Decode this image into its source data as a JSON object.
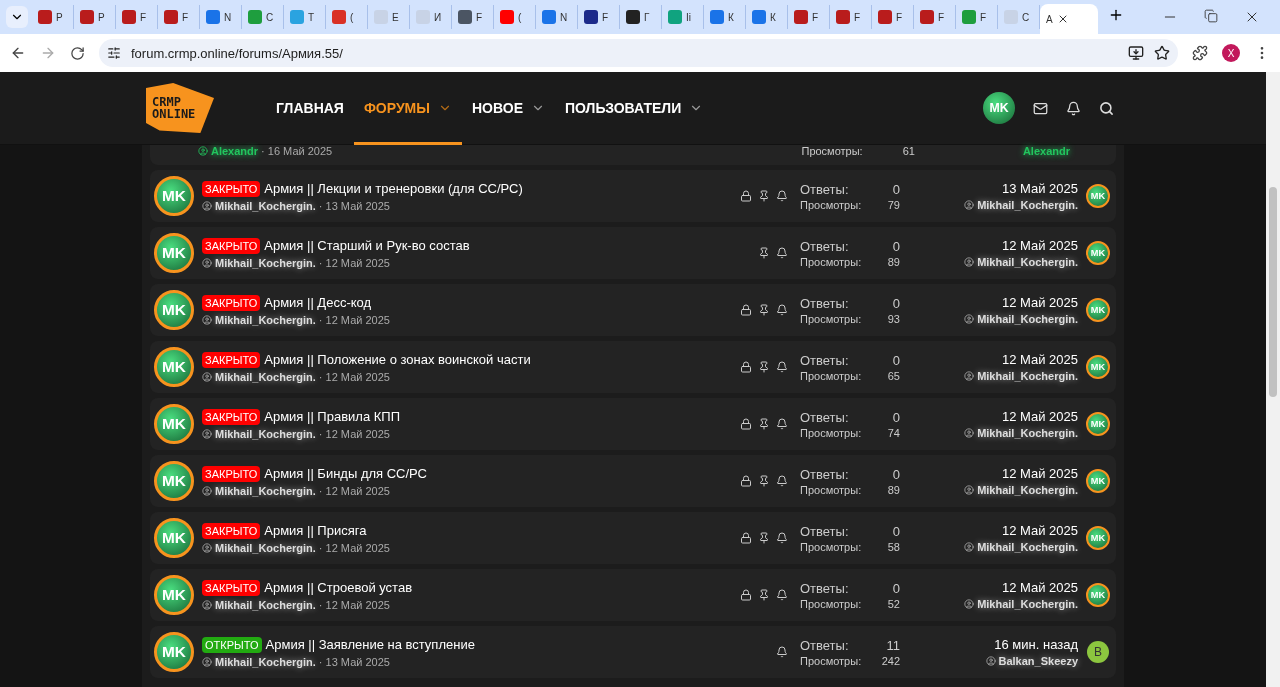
{
  "browser": {
    "tabs": [
      {
        "title": "Р",
        "color": "#b91c1c",
        "selected": false
      },
      {
        "title": "Р",
        "color": "#b91c1c",
        "selected": false
      },
      {
        "title": "F",
        "color": "#b91c1c",
        "selected": false
      },
      {
        "title": "F",
        "color": "#b91c1c",
        "selected": false
      },
      {
        "title": "N",
        "color": "#1a73e8",
        "selected": false
      },
      {
        "title": "С",
        "color": "#1e9e3e",
        "selected": false
      },
      {
        "title": "Т",
        "color": "#2aa3e0",
        "selected": false
      },
      {
        "title": "(",
        "color": "#d93025",
        "selected": false
      },
      {
        "title": "Е",
        "color": "#c8d3e6",
        "selected": false
      },
      {
        "title": "И",
        "color": "#c8d3e6",
        "selected": false
      },
      {
        "title": "F",
        "color": "#4b5563",
        "selected": false
      },
      {
        "title": "(",
        "color": "#ff0000",
        "selected": false
      },
      {
        "title": "N",
        "color": "#1a73e8",
        "selected": false
      },
      {
        "title": "F",
        "color": "#1c2a8a",
        "selected": false
      },
      {
        "title": "Г",
        "color": "#222222",
        "selected": false
      },
      {
        "title": "Іі",
        "color": "#10a37f",
        "selected": false
      },
      {
        "title": "К",
        "color": "#1a73e8",
        "selected": false
      },
      {
        "title": "К",
        "color": "#1a73e8",
        "selected": false
      },
      {
        "title": "F",
        "color": "#b91c1c",
        "selected": false
      },
      {
        "title": "F",
        "color": "#b91c1c",
        "selected": false
      },
      {
        "title": "F",
        "color": "#b91c1c",
        "selected": false
      },
      {
        "title": "F",
        "color": "#b91c1c",
        "selected": false
      },
      {
        "title": "F",
        "color": "#1e9e3e",
        "selected": false
      },
      {
        "title": "С",
        "color": "#c8d3e6",
        "selected": false
      },
      {
        "title": "А",
        "selected": true
      }
    ],
    "url": "forum.crmp.online/forums/Армия.55/",
    "profile_letter": "X"
  },
  "header": {
    "logo": [
      "CRMP",
      "ONLINE"
    ],
    "nav": [
      {
        "label": "ГЛАВНАЯ",
        "has_menu": false,
        "selected": false
      },
      {
        "label": "ФОРУМЫ",
        "has_menu": true,
        "selected": true
      },
      {
        "label": "НОВОЕ",
        "has_menu": true,
        "selected": false
      },
      {
        "label": "ПОЛЬЗОВАТЕЛИ",
        "has_menu": true,
        "selected": false
      }
    ],
    "user_avatar": "MK"
  },
  "partial_row": {
    "author": "Alexandr",
    "color": "#22c55e",
    "date": "· 16 Май 2025",
    "views_label": "Просмотры:",
    "views": "61",
    "last_author": "Alexandr"
  },
  "threads": [
    {
      "avatar": "MK",
      "status": "ЗАКРЫТО",
      "closed": true,
      "title": "Армия || Лекции и тренеровки (для СС/РС)",
      "author": "Mikhail_Kochergin.",
      "date": "· 13 Май 2025",
      "locked": true,
      "pinned": true,
      "watched": true,
      "replies_label": "Ответы:",
      "replies": "0",
      "views_label": "Просмотры:",
      "views": "79",
      "last_date": "13 Май 2025",
      "last_author": "Mikhail_Kochergin.",
      "last_avatar": {
        "kind": "image",
        "text": "MK"
      }
    },
    {
      "avatar": "MK",
      "status": "ЗАКРЫТО",
      "closed": true,
      "title": "Армия || Старший и Рук-во состав",
      "author": "Mikhail_Kochergin.",
      "date": "· 12 Май 2025",
      "locked": false,
      "pinned": true,
      "watched": true,
      "replies_label": "Ответы:",
      "replies": "0",
      "views_label": "Просмотры:",
      "views": "89",
      "last_date": "12 Май 2025",
      "last_author": "Mikhail_Kochergin.",
      "last_avatar": {
        "kind": "image",
        "text": "MK"
      }
    },
    {
      "avatar": "MK",
      "status": "ЗАКРЫТО",
      "closed": true,
      "title": "Армия || Десс-код",
      "author": "Mikhail_Kochergin.",
      "date": "· 12 Май 2025",
      "locked": true,
      "pinned": true,
      "watched": true,
      "replies_label": "Ответы:",
      "replies": "0",
      "views_label": "Просмотры:",
      "views": "93",
      "last_date": "12 Май 2025",
      "last_author": "Mikhail_Kochergin.",
      "last_avatar": {
        "kind": "image",
        "text": "MK"
      }
    },
    {
      "avatar": "MK",
      "status": "ЗАКРЫТО",
      "closed": true,
      "title": "Армия || Положение о зонах воинской части",
      "author": "Mikhail_Kochergin.",
      "date": "· 12 Май 2025",
      "locked": true,
      "pinned": true,
      "watched": true,
      "replies_label": "Ответы:",
      "replies": "0",
      "views_label": "Просмотры:",
      "views": "65",
      "last_date": "12 Май 2025",
      "last_author": "Mikhail_Kochergin.",
      "last_avatar": {
        "kind": "image",
        "text": "MK"
      }
    },
    {
      "avatar": "MK",
      "status": "ЗАКРЫТО",
      "closed": true,
      "title": "Армия || Правила КПП",
      "author": "Mikhail_Kochergin.",
      "date": "· 12 Май 2025",
      "locked": true,
      "pinned": true,
      "watched": true,
      "replies_label": "Ответы:",
      "replies": "0",
      "views_label": "Просмотры:",
      "views": "74",
      "last_date": "12 Май 2025",
      "last_author": "Mikhail_Kochergin.",
      "last_avatar": {
        "kind": "image",
        "text": "MK"
      }
    },
    {
      "avatar": "MK",
      "status": "ЗАКРЫТО",
      "closed": true,
      "title": "Армия || Бинды для СС/РС",
      "author": "Mikhail_Kochergin.",
      "date": "· 12 Май 2025",
      "locked": true,
      "pinned": true,
      "watched": true,
      "replies_label": "Ответы:",
      "replies": "0",
      "views_label": "Просмотры:",
      "views": "89",
      "last_date": "12 Май 2025",
      "last_author": "Mikhail_Kochergin.",
      "last_avatar": {
        "kind": "image",
        "text": "MK"
      }
    },
    {
      "avatar": "MK",
      "status": "ЗАКРЫТО",
      "closed": true,
      "title": "Армия || Присяга",
      "author": "Mikhail_Kochergin.",
      "date": "· 12 Май 2025",
      "locked": true,
      "pinned": true,
      "watched": true,
      "replies_label": "Ответы:",
      "replies": "0",
      "views_label": "Просмотры:",
      "views": "58",
      "last_date": "12 Май 2025",
      "last_author": "Mikhail_Kochergin.",
      "last_avatar": {
        "kind": "image",
        "text": "MK"
      }
    },
    {
      "avatar": "MK",
      "status": "ЗАКРЫТО",
      "closed": true,
      "title": "Армия || Строевой устав",
      "author": "Mikhail_Kochergin.",
      "date": "· 12 Май 2025",
      "locked": true,
      "pinned": true,
      "watched": true,
      "replies_label": "Ответы:",
      "replies": "0",
      "views_label": "Просмотры:",
      "views": "52",
      "last_date": "12 Май 2025",
      "last_author": "Mikhail_Kochergin.",
      "last_avatar": {
        "kind": "image",
        "text": "MK"
      }
    },
    {
      "avatar": "MK",
      "status": "ОТКРЫТО",
      "closed": false,
      "title": "Армия || Заявление на вступление",
      "author": "Mikhail_Kochergin.",
      "date": "· 13 Май 2025",
      "locked": false,
      "pinned": false,
      "watched": true,
      "replies_label": "Ответы:",
      "replies": "11",
      "views_label": "Просмотры:",
      "views": "242",
      "last_date": "16 мин. назад",
      "last_author": "Balkan_Skeezy",
      "last_avatar": {
        "kind": "letter",
        "text": "B"
      }
    }
  ]
}
